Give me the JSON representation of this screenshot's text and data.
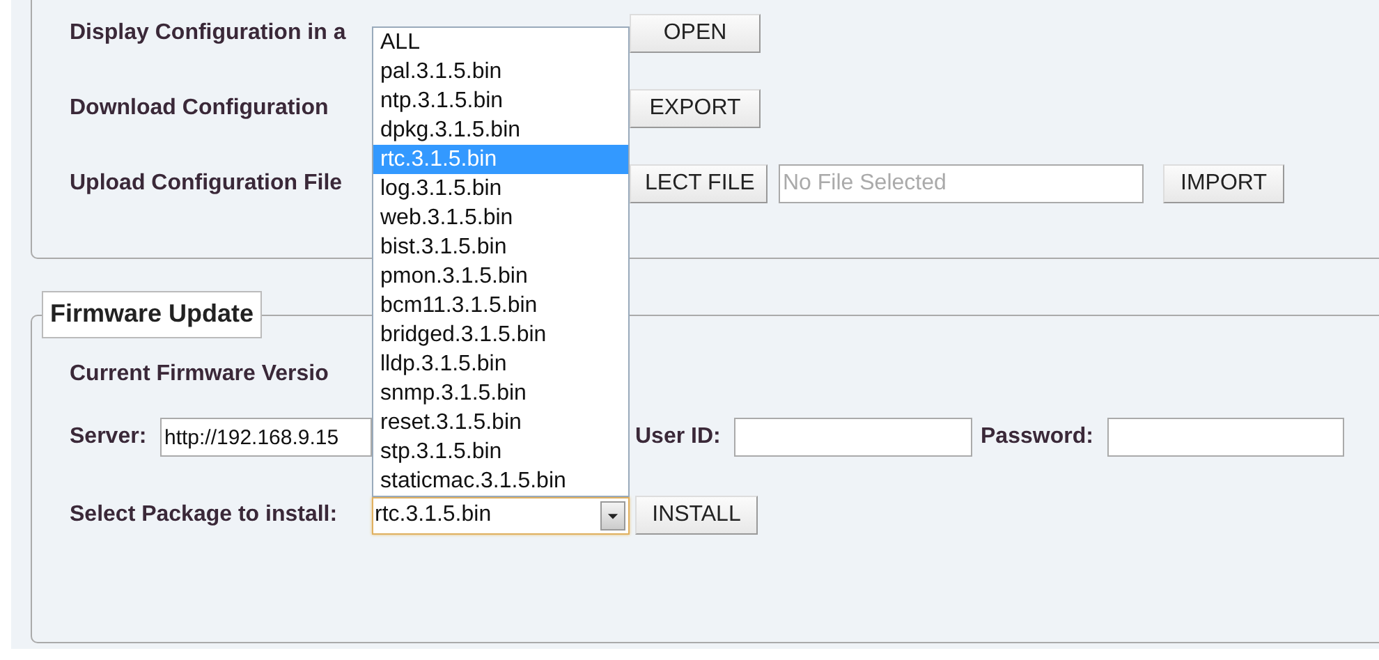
{
  "config_section": {
    "rows": [
      {
        "label": "Display Configuration in a",
        "button": "OPEN"
      },
      {
        "label": "Download Configuration",
        "button": "EXPORT"
      },
      {
        "label": "Upload Configuration File",
        "button": "LECT FILE",
        "file_field": {
          "placeholder": "No File Selected"
        },
        "button_2": "IMPORT"
      }
    ]
  },
  "firmware_section": {
    "legend": "Firmware Update",
    "current_version_label": "Current Firmware Versio",
    "server": {
      "label": "Server:",
      "value": "http://192.168.9.15"
    },
    "user_id": {
      "label": "User ID:"
    },
    "password": {
      "label": "Password:"
    },
    "package": {
      "label": "Select Package to install:",
      "value": "rtc.3.1.5.bin",
      "expanded": true,
      "options": [
        {
          "label": "ALL",
          "selected": false
        },
        {
          "label": "pal.3.1.5.bin",
          "selected": false
        },
        {
          "label": "ntp.3.1.5.bin",
          "selected": false
        },
        {
          "label": "dpkg.3.1.5.bin",
          "selected": false
        },
        {
          "label": "rtc.3.1.5.bin",
          "selected": true
        },
        {
          "label": "log.3.1.5.bin",
          "selected": false
        },
        {
          "label": "web.3.1.5.bin",
          "selected": false
        },
        {
          "label": "bist.3.1.5.bin",
          "selected": false
        },
        {
          "label": "pmon.3.1.5.bin",
          "selected": false
        },
        {
          "label": "bcm11.3.1.5.bin",
          "selected": false
        },
        {
          "label": "bridged.3.1.5.bin",
          "selected": false
        },
        {
          "label": "lldp.3.1.5.bin",
          "selected": false
        },
        {
          "label": "snmp.3.1.5.bin",
          "selected": false
        },
        {
          "label": "reset.3.1.5.bin",
          "selected": false
        },
        {
          "label": "stp.3.1.5.bin",
          "selected": false
        },
        {
          "label": "staticmac.3.1.5.bin",
          "selected": false
        }
      ]
    },
    "install_button": "INSTALL"
  }
}
